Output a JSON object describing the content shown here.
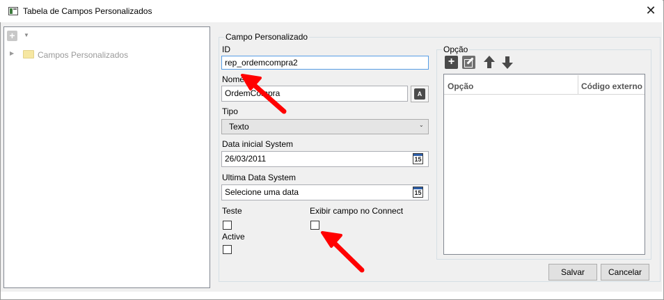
{
  "window": {
    "title": "Tabela de Campos Personalizados",
    "close_label": "✕"
  },
  "tree": {
    "root_label": "Campos Personalizados",
    "expander": "▶",
    "add_icon": "+",
    "dropdown_icon": "▼"
  },
  "form": {
    "group_title": "Campo Personalizado",
    "id": {
      "label": "ID",
      "value": "rep_ordemcompra2"
    },
    "name": {
      "label": "Nome",
      "value": "OrdemCompra",
      "translate_icon": "A"
    },
    "tipo": {
      "label": "Tipo",
      "value": "Texto",
      "chevron": "⌄"
    },
    "data_inicial": {
      "label": "Data inicial System",
      "value": "26/03/2011",
      "calendar_day": "15"
    },
    "ultima_data": {
      "label": "Ultima Data System",
      "placeholder": "Selecione uma data",
      "calendar_day": "15"
    },
    "teste": {
      "label": "Teste",
      "checked": false
    },
    "active": {
      "label": "Active",
      "checked": false
    },
    "exibir": {
      "label": "Exibir campo no Connect",
      "checked": false
    }
  },
  "options": {
    "group_title": "Opção",
    "toolbar": {
      "add_icon": "+"
    },
    "columns": [
      "Opção",
      "Código externo"
    ],
    "rows": []
  },
  "buttons": {
    "save": "Salvar",
    "cancel": "Cancelar"
  },
  "annotations": {
    "arrow_color": "#ff0000"
  }
}
